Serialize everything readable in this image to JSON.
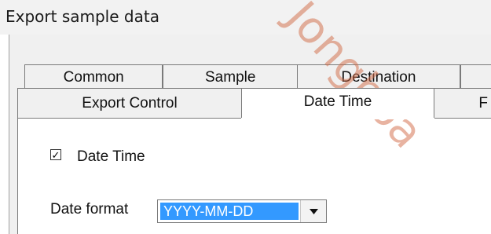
{
  "window": {
    "title": "Export sample data"
  },
  "watermark": "Jonghoa",
  "tabs_row1": [
    "Common",
    "Sample",
    "Destination",
    ""
  ],
  "tabs_row2": [
    "Export Control",
    "Date Time",
    "F"
  ],
  "active_tab": "Date Time",
  "options": {
    "datetime_checkbox": {
      "label": "Date Time",
      "checked": true,
      "mark": "✓"
    },
    "date_format": {
      "label": "Date format",
      "value": "YYYY-MM-DD"
    }
  },
  "colors": {
    "selection": "#3399ff",
    "watermark": "#d26a45"
  }
}
